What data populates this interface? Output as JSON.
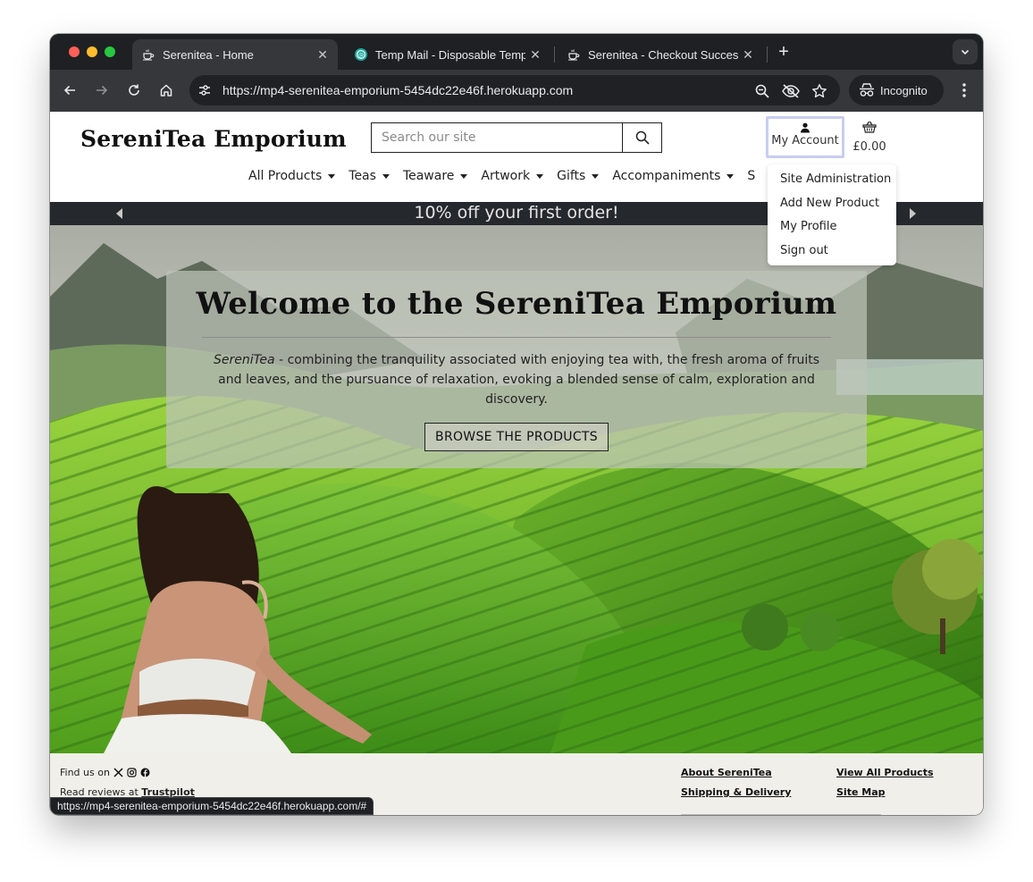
{
  "browser": {
    "tabs": [
      {
        "title": "Serenitea - Home",
        "icon": "teacup-icon",
        "active": true
      },
      {
        "title": "Temp Mail - Disposable Temp",
        "icon": "tempmail-icon",
        "active": false
      },
      {
        "title": "Serenitea - Checkout Succes",
        "icon": "teacup-icon",
        "active": false
      }
    ],
    "url": "https://mp4-serenitea-emporium-5454dc22e46f.herokuapp.com",
    "incognito_label": "Incognito",
    "status_url": "https://mp4-serenitea-emporium-5454dc22e46f.herokuapp.com/#"
  },
  "site": {
    "brand": "SereniTea Emporium",
    "search_placeholder": "Search our site",
    "account_label": "My Account",
    "basket_total": "£0.00",
    "nav": [
      "All Products",
      "Teas",
      "Teaware",
      "Artwork",
      "Gifts",
      "Accompaniments"
    ],
    "nav_partial": "S",
    "account_menu": [
      "Site Administration",
      "Add New Product",
      "My Profile",
      "Sign out"
    ],
    "banner": "10% off your first order!",
    "hero": {
      "title": "Welcome to the SereniTea Emporium",
      "tagline_brand": "SereniTea",
      "tagline": " - combining the tranquility associated with enjoying tea with, the fresh aroma of fruits and leaves, and the pursuance of relaxation, evoking a blended sense of calm, exploration and discovery.",
      "cta": "BROWSE THE PRODUCTS"
    },
    "footer": {
      "find_us": "Find us on",
      "social_icons": [
        "x-icon",
        "instagram-icon",
        "facebook-icon"
      ],
      "reviews_prefix": "Read reviews at",
      "reviews_link": "Trustpilot",
      "links": [
        "About SereniTea",
        "View All Products",
        "Shipping & Delivery",
        "Site Map"
      ]
    }
  },
  "colors": {
    "chrome_dark": "#1f2023",
    "chrome_toolbar": "#36373b",
    "banner_bg": "#25292d",
    "account_outline": "#c9cdf3",
    "footer_bg": "#f0efe9"
  }
}
